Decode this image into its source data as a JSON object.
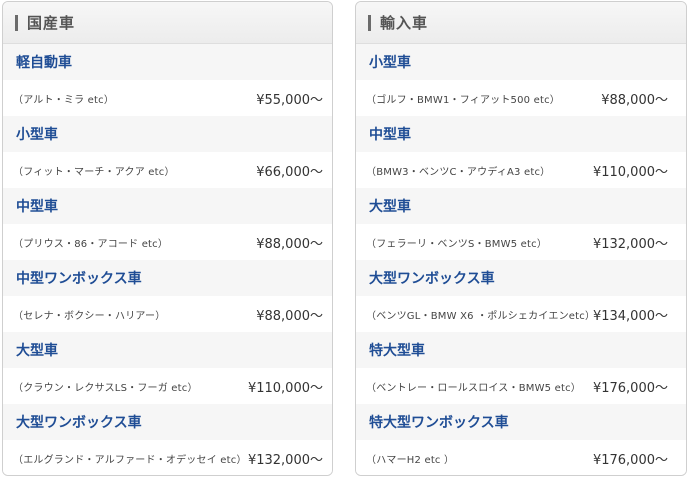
{
  "domestic": {
    "title": "国産車",
    "rows": [
      {
        "category": "軽自動車",
        "desc": "（アルト・ミラ etc）",
        "price": "¥55,000〜"
      },
      {
        "category": "小型車",
        "desc": "（フィット・マーチ・アクア etc）",
        "price": "¥66,000〜"
      },
      {
        "category": "中型車",
        "desc": "（プリウス・86・アコード etc）",
        "price": "¥88,000〜"
      },
      {
        "category": "中型ワンボックス車",
        "desc": "（セレナ・ボクシー・ハリアー）",
        "price": "¥88,000〜"
      },
      {
        "category": "大型車",
        "desc": "（クラウン・レクサスLS・フーガ etc）",
        "price": "¥110,000〜"
      },
      {
        "category": "大型ワンボックス車",
        "desc": "（エルグランド・アルファード・オデッセイ etc）",
        "price": "¥132,000〜"
      }
    ]
  },
  "imported": {
    "title": "輸入車",
    "rows": [
      {
        "category": "小型車",
        "desc": "（ゴルフ・BMW1・フィアット500 etc）",
        "price": "¥88,000〜"
      },
      {
        "category": "中型車",
        "desc": "（BMW3・ベンツC・アウディA3 etc）",
        "price": "¥110,000〜"
      },
      {
        "category": "大型車",
        "desc": "（フェラーリ・ベンツS・BMW5 etc）",
        "price": "¥132,000〜"
      },
      {
        "category": "大型ワンボックス車",
        "desc": "（ベンツGL・BMW X6 ・ポルシェカイエンetc）",
        "price": "¥134,000〜"
      },
      {
        "category": "特大型車",
        "desc": "（ベントレー・ロールスロイス・BMW5 etc）",
        "price": "¥176,000〜"
      },
      {
        "category": "特大型ワンボックス車",
        "desc": "（ハマーH2 etc ）",
        "price": "¥176,000〜"
      }
    ]
  }
}
